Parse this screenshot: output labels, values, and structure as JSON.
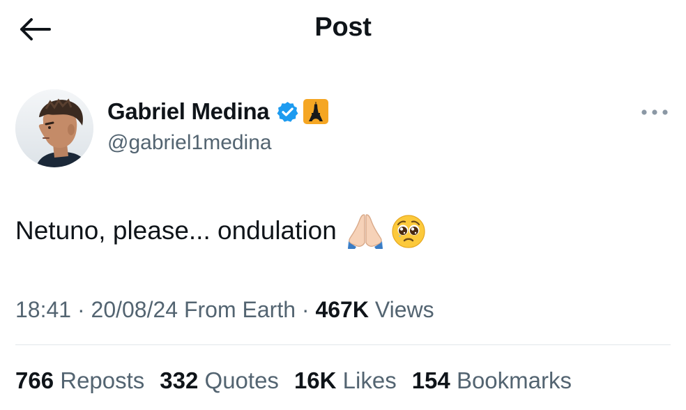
{
  "header": {
    "title": "Post",
    "back_icon": "arrow-left-icon"
  },
  "author": {
    "display_name": "Gabriel Medina",
    "handle": "@gabriel1medina",
    "verified_icon": "verified-badge-icon",
    "affiliation_icon": "eiffel-tower-badge-icon"
  },
  "post": {
    "text": "Netuno, please... ondulation",
    "emojis": [
      "folded-hands-emoji",
      "pleading-face-emoji"
    ]
  },
  "meta": {
    "time": "18:41",
    "date": "20/08/24",
    "source": "From Earth",
    "views_count": "467K",
    "views_label": "Views"
  },
  "stats": [
    {
      "count": "766",
      "label": "Reposts"
    },
    {
      "count": "332",
      "label": "Quotes"
    },
    {
      "count": "16K",
      "label": "Likes"
    },
    {
      "count": "154",
      "label": "Bookmarks"
    }
  ],
  "colors": {
    "text_primary": "#0f1419",
    "text_secondary": "#536471",
    "verified_blue": "#1d9bf0",
    "badge_gold": "#f5a623",
    "divider": "#e1e6ea"
  }
}
